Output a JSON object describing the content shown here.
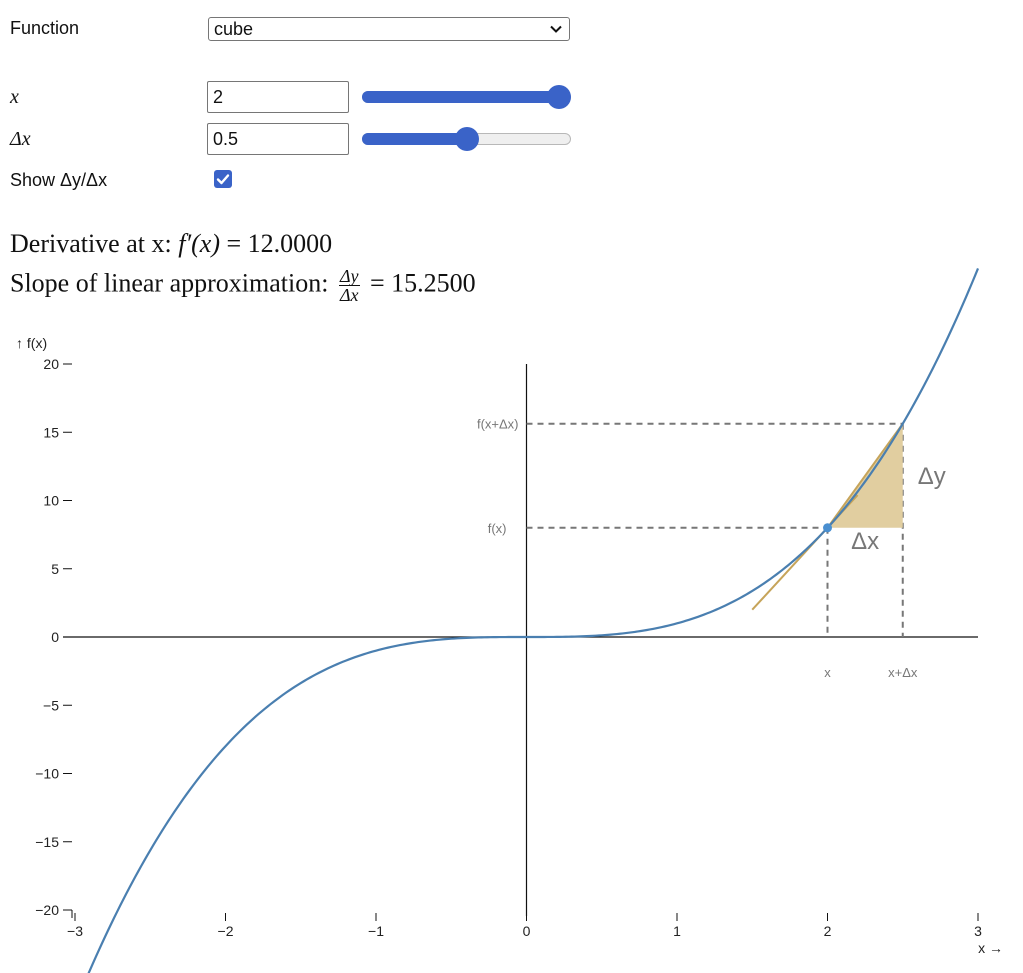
{
  "controls": {
    "function_label": "Function",
    "function_value": "cube",
    "x_label": "x",
    "x_value": "2",
    "x_slider_fraction": 1.0,
    "dx_label": "Δx",
    "dx_value": "0.5",
    "dx_slider_fraction": 0.5,
    "show_label": "Show Δy/Δx",
    "show_checked": true
  },
  "readout": {
    "derivative_prefix": "Derivative at x:",
    "derivative_value": "12.0000",
    "slope_prefix": "Slope of linear approximation:",
    "slope_value": "15.2500"
  },
  "colors": {
    "curve": "#4a7fb0",
    "tangent": "#c6a45a",
    "triangle_fill": "#e1cea0",
    "point": "#4a8fd0",
    "accent": "#3a63c8",
    "dashed": "#777777",
    "axis": "#111111"
  },
  "chart_data": {
    "type": "line",
    "function": "cube",
    "x": 2,
    "dx": 0.5,
    "fx": 8,
    "fx_dx": 15.625,
    "derivative": 12,
    "slope": 15.25,
    "xlim": [
      -3,
      3
    ],
    "ylim": [
      -20,
      20
    ],
    "x_ticks": [
      -3,
      -2,
      -1,
      0,
      1,
      2,
      3
    ],
    "y_ticks": [
      20,
      15,
      10,
      5,
      0,
      -5,
      -10,
      -15,
      -20
    ],
    "x_tick_labels": [
      "−3",
      "−2",
      "−1",
      "0",
      "1",
      "2",
      "3"
    ],
    "y_tick_labels": [
      "20",
      "15",
      "10",
      "5",
      "0",
      "−5",
      "−10",
      "−15",
      "−20"
    ],
    "xlabel": "x →",
    "ylabel": "↑ f(x)",
    "annotations": {
      "fx_label": "f(x)",
      "fxdx_label": "f(x+Δx)",
      "x_label": "x",
      "xdx_label": "x+Δx",
      "dx_label": "Δx",
      "dy_label": "Δy"
    }
  }
}
